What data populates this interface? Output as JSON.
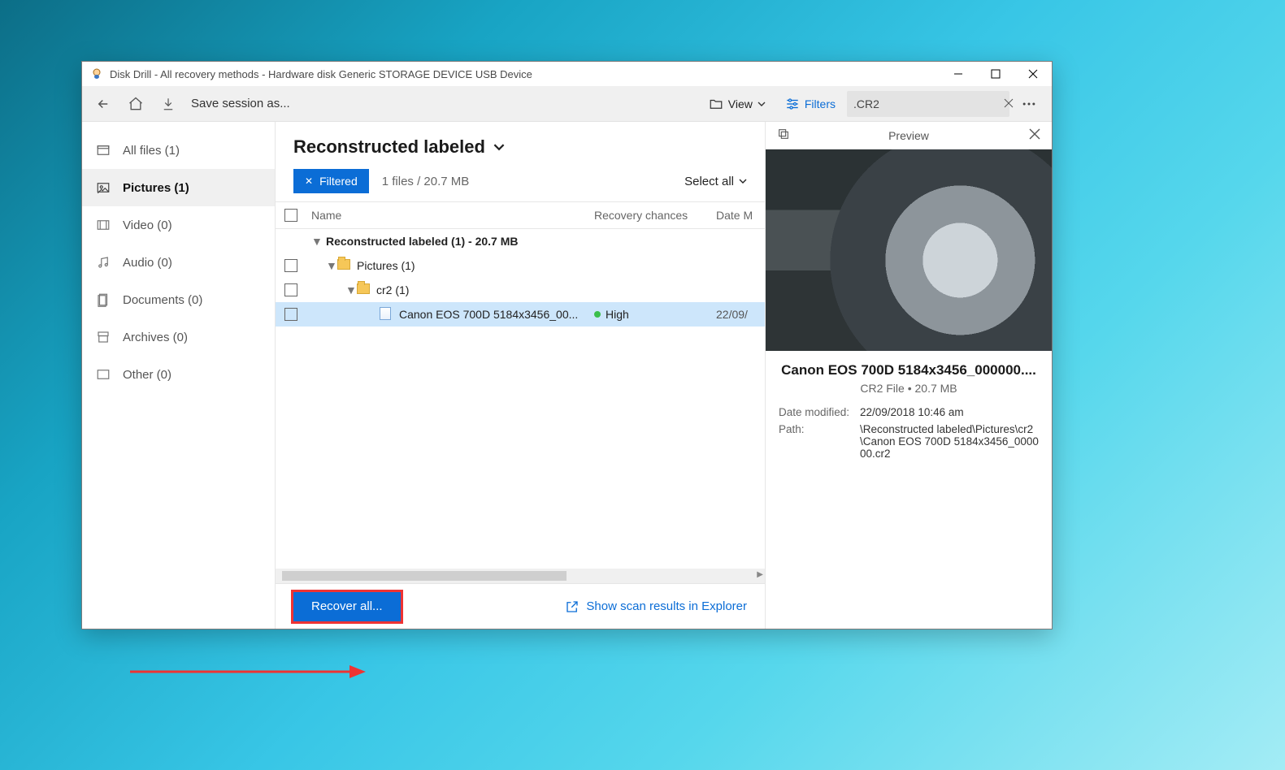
{
  "window": {
    "title": "Disk Drill - All recovery methods - Hardware disk Generic STORAGE DEVICE USB Device"
  },
  "toolbar": {
    "save_session": "Save session as...",
    "view": "View",
    "filters": "Filters",
    "search_value": ".CR2"
  },
  "sidebar": {
    "items": [
      {
        "label": "All files (1)"
      },
      {
        "label": "Pictures (1)"
      },
      {
        "label": "Video (0)"
      },
      {
        "label": "Audio (0)"
      },
      {
        "label": "Documents (0)"
      },
      {
        "label": "Archives (0)"
      },
      {
        "label": "Other (0)"
      }
    ]
  },
  "center": {
    "title": "Reconstructed labeled",
    "chip_label": "Filtered",
    "stat": "1 files / 20.7 MB",
    "select_all": "Select all",
    "columns": {
      "name": "Name",
      "chances": "Recovery chances",
      "date": "Date M"
    },
    "rows": {
      "group": "Reconstructed labeled (1) - 20.7 MB",
      "folder1": "Pictures (1)",
      "folder2": "cr2 (1)",
      "file": {
        "name": "Canon EOS 700D 5184x3456_00...",
        "chances": "High",
        "date": "22/09/"
      }
    }
  },
  "preview": {
    "label": "Preview",
    "file_name": "Canon EOS 700D 5184x3456_000000....",
    "subtitle": "CR2 File • 20.7 MB",
    "date_modified_k": "Date modified:",
    "date_modified_v": "22/09/2018 10:46 am",
    "path_k": "Path:",
    "path_v": "\\Reconstructed labeled\\Pictures\\cr2\\Canon EOS 700D 5184x3456_000000.cr2"
  },
  "footer": {
    "recover": "Recover all...",
    "explorer": "Show scan results in Explorer"
  }
}
